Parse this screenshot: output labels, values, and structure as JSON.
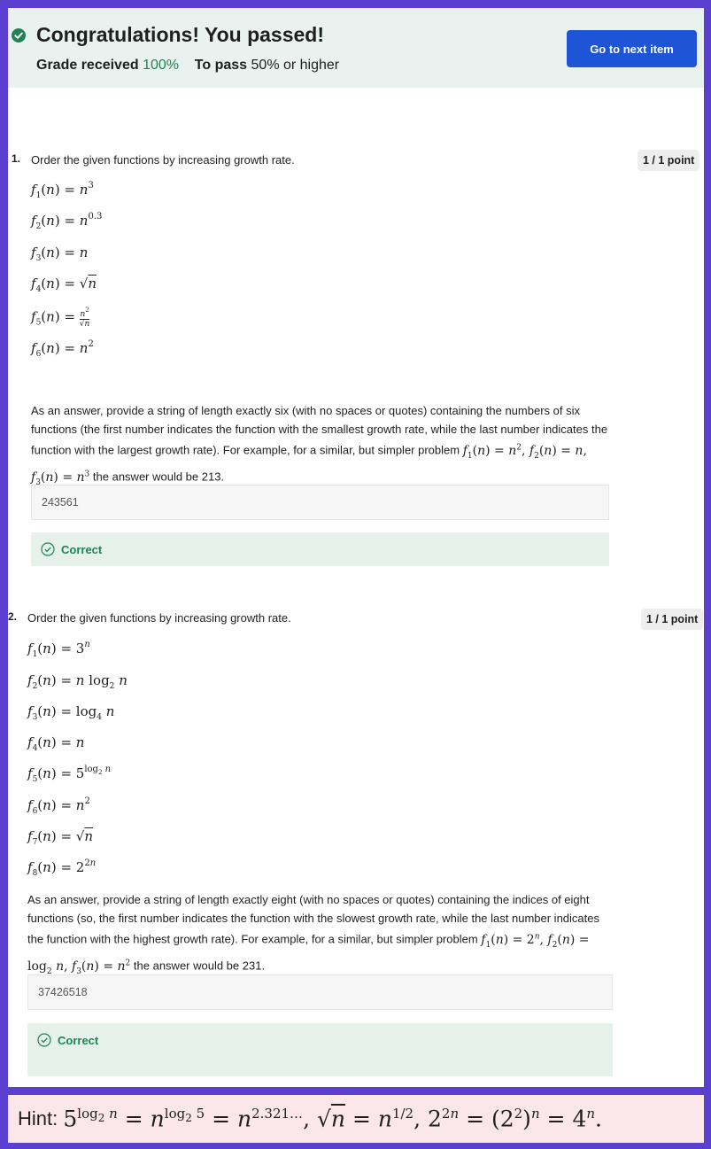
{
  "banner": {
    "title": "Congratulations! You passed!",
    "grade_label": "Grade received",
    "grade_value": "100%",
    "pass_label": "To pass",
    "pass_value": "50% or higher",
    "next_button": "Go to next item"
  },
  "questions": [
    {
      "number": "1.",
      "prompt": "Order the given functions by increasing growth rate.",
      "points": "1 / 1 point",
      "instructions_a": "As an answer, provide a string of length exactly six (with no spaces or quotes) containing the numbers of six functions (the first number indicates the function with the smallest growth rate, while the last number indicates the function with the largest growth rate). For example, for a similar, but simpler problem",
      "instructions_b": "the answer would be 213.",
      "answer": "243561",
      "feedback": "Correct"
    },
    {
      "number": "2.",
      "prompt": "Order the given functions by increasing growth rate.",
      "points": "1 / 1 point",
      "instructions_a": "As an answer, provide a string of length exactly eight (with no spaces or quotes) containing the indices of eight functions (so, the first number indicates the function with the slowest growth rate, while the last number indicates the function with the highest growth rate). For example, for a similar, but simpler problem",
      "instructions_b": "the answer would be 231.",
      "answer": "37426518",
      "feedback": "Correct"
    }
  ],
  "hint_label": "Hint:",
  "colors": {
    "accent": "#1d55d6",
    "success": "#1f8354",
    "border": "#5b3fd1"
  }
}
